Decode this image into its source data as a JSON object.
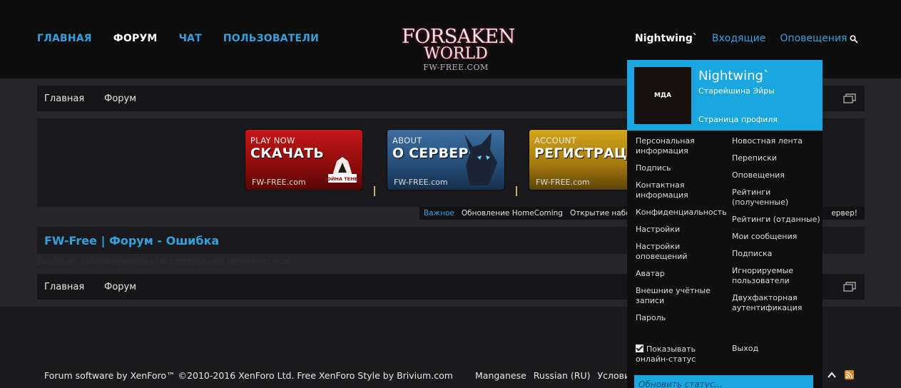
{
  "nav": {
    "left": [
      "ГЛАВНАЯ",
      "ФОРУМ",
      "ЧАТ",
      "ПОЛЬЗОВАТЕЛИ"
    ],
    "username": "Nightwing`",
    "inbox": "Входящие",
    "alerts": "Оповещения"
  },
  "logo": {
    "line1": "FORSAKEN",
    "line2": "WORLD",
    "line3": "FW-FREE.COM"
  },
  "breadcrumb": {
    "home": "Главная",
    "forum": "Форум"
  },
  "banners": [
    {
      "top": "PLAY NOW",
      "big": "СКАЧАТЬ",
      "site": "FW-FREE.com",
      "badge": "ВОЙНА ТЕНЕЙ"
    },
    {
      "top": "ABOUT",
      "big": "О СЕРВЕРЕ",
      "site": "FW-FREE.com"
    },
    {
      "top": "ACCOUNT",
      "big": "РЕГИСТРАЦИЯ",
      "site": "FW-FREE.com"
    }
  ],
  "ticker": {
    "label": "Важное",
    "item1": "Обновление HomeComing",
    "item2": "Открытие набора в",
    "tail": "ервер!"
  },
  "page": {
    "title": "FW-Free | Форум - Ошибка",
    "error": "Вы были заблокированы по следующей причине: псж"
  },
  "footer": {
    "copyright": "Forum software by XenForo™ ©2010-2016 XenForo Ltd. Free XenForo Style by Brivium.com",
    "style": "Manganese",
    "language": "Russian (RU)",
    "terms": "Условия и"
  },
  "dropdown": {
    "avatar_text": "МДА",
    "name": "Nightwing`",
    "rank": "Старейшина Эйры",
    "profile_link": "Страница профиля",
    "col1": [
      "Персональная информация",
      "Подпись",
      "Контактная информация",
      "Конфиденциальность",
      "Настройки",
      "Настройки оповещений",
      "Аватар",
      "Внешние учётные записи",
      "Пароль"
    ],
    "col2": [
      "Новостная лента",
      "Переписки",
      "Оповещения",
      "Рейтинги (полученные)",
      "Рейтинги (отданные)",
      "Мои сообщения",
      "Подписка",
      "Игнорируемые пользователи",
      "Двухфакторная аутентификация"
    ],
    "show_online": "Показывать онлайн-статус",
    "logout": "Выход",
    "status_placeholder": "Обновить статус..."
  },
  "colors": {
    "accent": "#1aa7e0",
    "link": "#34a0dd"
  }
}
